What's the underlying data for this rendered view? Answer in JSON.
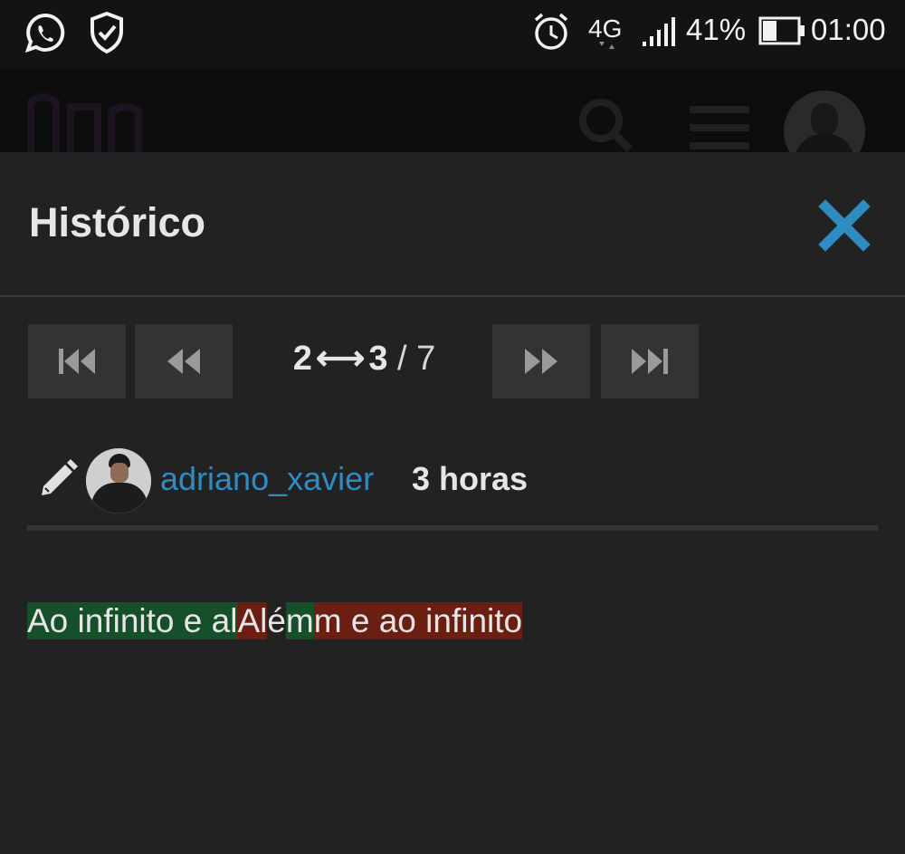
{
  "status_bar": {
    "network": "4G",
    "battery_percent": "41%",
    "battery_level": 0.41,
    "time": "01:00",
    "icons": [
      "whatsapp-icon",
      "shield-check-icon",
      "alarm-icon",
      "signal-icon",
      "battery-icon"
    ]
  },
  "modal": {
    "title": "Histórico",
    "pager": {
      "from": "2",
      "arrow": "⟷",
      "to": "3",
      "separator": " / ",
      "total": "7"
    },
    "revision": {
      "username": "adriano_xavier",
      "time_ago": "3 horas"
    },
    "diff": [
      {
        "type": "ins",
        "text": "Ao infinito e al"
      },
      {
        "type": "del",
        "text": "Al"
      },
      {
        "type": "same",
        "text": "é"
      },
      {
        "type": "ins",
        "text": "m"
      },
      {
        "type": "del",
        "text": "m e ao infinito"
      }
    ]
  },
  "colors": {
    "background": "#222222",
    "accent_blue": "#2f8cc2",
    "insert_bg": "#15502b",
    "delete_bg": "#6a1f12"
  }
}
